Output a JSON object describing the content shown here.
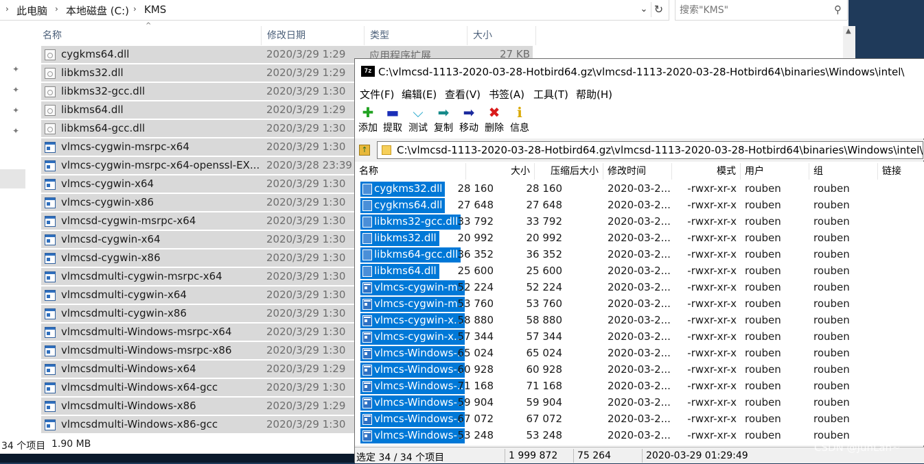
{
  "explorer": {
    "breadcrumb": [
      "此电脑",
      "本地磁盘 (C:)",
      "KMS"
    ],
    "search_placeholder": "搜索\"KMS\"",
    "columns": {
      "name": "名称",
      "date": "修改日期",
      "type": "类型",
      "size": "大小"
    },
    "files": [
      {
        "name": "cygkms64.dll",
        "date": "2020/3/29 1:29",
        "type": "应用程序扩展",
        "size": "27 KB",
        "kind": "dll"
      },
      {
        "name": "libkms32.dll",
        "date": "2020/3/29 1:29",
        "kind": "dll"
      },
      {
        "name": "libkms32-gcc.dll",
        "date": "2020/3/29 1:30",
        "kind": "dll"
      },
      {
        "name": "libkms64.dll",
        "date": "2020/3/29 1:29",
        "kind": "dll"
      },
      {
        "name": "libkms64-gcc.dll",
        "date": "2020/3/29 1:30",
        "kind": "dll"
      },
      {
        "name": "vlmcs-cygwin-msrpc-x64",
        "date": "2020/3/29 1:30",
        "kind": "exe"
      },
      {
        "name": "vlmcs-cygwin-msrpc-x64-openssl-EX...",
        "date": "2020/3/28 23:39",
        "kind": "exe"
      },
      {
        "name": "vlmcs-cygwin-x64",
        "date": "2020/3/29 1:30",
        "kind": "exe"
      },
      {
        "name": "vlmcs-cygwin-x86",
        "date": "2020/3/29 1:30",
        "kind": "exe"
      },
      {
        "name": "vlmcsd-cygwin-msrpc-x64",
        "date": "2020/3/29 1:30",
        "kind": "exe"
      },
      {
        "name": "vlmcsd-cygwin-x64",
        "date": "2020/3/29 1:30",
        "kind": "exe"
      },
      {
        "name": "vlmcsd-cygwin-x86",
        "date": "2020/3/29 1:30",
        "kind": "exe"
      },
      {
        "name": "vlmcsdmulti-cygwin-msrpc-x64",
        "date": "2020/3/29 1:30",
        "kind": "exe"
      },
      {
        "name": "vlmcsdmulti-cygwin-x64",
        "date": "2020/3/29 1:30",
        "kind": "exe"
      },
      {
        "name": "vlmcsdmulti-cygwin-x86",
        "date": "2020/3/29 1:30",
        "kind": "exe"
      },
      {
        "name": "vlmcsdmulti-Windows-msrpc-x64",
        "date": "2020/3/29 1:30",
        "kind": "exe"
      },
      {
        "name": "vlmcsdmulti-Windows-msrpc-x86",
        "date": "2020/3/29 1:30",
        "kind": "exe"
      },
      {
        "name": "vlmcsdmulti-Windows-x64",
        "date": "2020/3/29 1:29",
        "kind": "exe"
      },
      {
        "name": "vlmcsdmulti-Windows-x64-gcc",
        "date": "2020/3/29 1:30",
        "kind": "exe"
      },
      {
        "name": "vlmcsdmulti-Windows-x86",
        "date": "2020/3/29 1:29",
        "kind": "exe"
      },
      {
        "name": "vlmcsdmulti-Windows-x86-gcc",
        "date": "2020/3/29 1:30",
        "kind": "exe"
      }
    ],
    "status": {
      "count": "34 个项目",
      "size": "1.90 MB"
    }
  },
  "sevenzip": {
    "title": "C:\\vlmcsd-1113-2020-03-28-Hotbird64.gz\\vlmcsd-1113-2020-03-28-Hotbird64\\binaries\\Windows\\intel\\",
    "logo": "7z",
    "menu": [
      "文件(F)",
      "编辑(E)",
      "查看(V)",
      "书签(A)",
      "工具(T)",
      "帮助(H)"
    ],
    "tools": [
      {
        "label": "添加",
        "icon": "add-icon",
        "color": "#22a322"
      },
      {
        "label": "提取",
        "icon": "extract-icon",
        "color": "#1b2fb8"
      },
      {
        "label": "测试",
        "icon": "test-icon",
        "color": "#19a3c9"
      },
      {
        "label": "复制",
        "icon": "copy-icon",
        "color": "#158a8a"
      },
      {
        "label": "移动",
        "icon": "move-icon",
        "color": "#1b2a9e"
      },
      {
        "label": "删除",
        "icon": "delete-icon",
        "color": "#d91c1c"
      },
      {
        "label": "信息",
        "icon": "info-icon",
        "color": "#d9a800"
      }
    ],
    "path": "C:\\vlmcsd-1113-2020-03-28-Hotbird64.gz\\vlmcsd-1113-2020-03-28-Hotbird64\\binaries\\Windows\\intel\\",
    "columns": {
      "name": "名称",
      "size": "大小",
      "packed": "压缩后大小",
      "modified": "修改时间",
      "mode": "模式",
      "user": "用户",
      "group": "组",
      "link": "链接"
    },
    "rows": [
      {
        "name": "cygkms32.dll",
        "size": "28 160",
        "packed": "28 160",
        "modified": "2020-03-2...",
        "mode": "-rwxr-xr-x",
        "user": "rouben",
        "group": "rouben",
        "kind": "dll"
      },
      {
        "name": "cygkms64.dll",
        "size": "27 648",
        "packed": "27 648",
        "modified": "2020-03-2...",
        "mode": "-rwxr-xr-x",
        "user": "rouben",
        "group": "rouben",
        "kind": "dll"
      },
      {
        "name": "libkms32-gcc.dll",
        "size": "33 792",
        "packed": "33 792",
        "modified": "2020-03-2...",
        "mode": "-rwxr-xr-x",
        "user": "rouben",
        "group": "rouben",
        "kind": "dll"
      },
      {
        "name": "libkms32.dll",
        "size": "20 992",
        "packed": "20 992",
        "modified": "2020-03-2...",
        "mode": "-rwxr-xr-x",
        "user": "rouben",
        "group": "rouben",
        "kind": "dll"
      },
      {
        "name": "libkms64-gcc.dll",
        "size": "36 352",
        "packed": "36 352",
        "modified": "2020-03-2...",
        "mode": "-rwxr-xr-x",
        "user": "rouben",
        "group": "rouben",
        "kind": "dll"
      },
      {
        "name": "libkms64.dll",
        "size": "25 600",
        "packed": "25 600",
        "modified": "2020-03-2...",
        "mode": "-rwxr-xr-x",
        "user": "rouben",
        "group": "rouben",
        "kind": "dll"
      },
      {
        "name": "vlmcs-cygwin-m...",
        "size": "52 224",
        "packed": "52 224",
        "modified": "2020-03-2...",
        "mode": "-rwxr-xr-x",
        "user": "rouben",
        "group": "rouben",
        "kind": "exe"
      },
      {
        "name": "vlmcs-cygwin-m...",
        "size": "53 760",
        "packed": "53 760",
        "modified": "2020-03-2...",
        "mode": "-rwxr-xr-x",
        "user": "rouben",
        "group": "rouben",
        "kind": "exe"
      },
      {
        "name": "vlmcs-cygwin-x...",
        "size": "58 880",
        "packed": "58 880",
        "modified": "2020-03-2...",
        "mode": "-rwxr-xr-x",
        "user": "rouben",
        "group": "rouben",
        "kind": "exe"
      },
      {
        "name": "vlmcs-cygwin-x...",
        "size": "57 344",
        "packed": "57 344",
        "modified": "2020-03-2...",
        "mode": "-rwxr-xr-x",
        "user": "rouben",
        "group": "rouben",
        "kind": "exe"
      },
      {
        "name": "vlmcs-Windows-...",
        "size": "65 024",
        "packed": "65 024",
        "modified": "2020-03-2...",
        "mode": "-rwxr-xr-x",
        "user": "rouben",
        "group": "rouben",
        "kind": "exe"
      },
      {
        "name": "vlmcs-Windows-...",
        "size": "60 928",
        "packed": "60 928",
        "modified": "2020-03-2...",
        "mode": "-rwxr-xr-x",
        "user": "rouben",
        "group": "rouben",
        "kind": "exe"
      },
      {
        "name": "vlmcs-Windows-...",
        "size": "71 168",
        "packed": "71 168",
        "modified": "2020-03-2...",
        "mode": "-rwxr-xr-x",
        "user": "rouben",
        "group": "rouben",
        "kind": "exe"
      },
      {
        "name": "vlmcs-Windows-...",
        "size": "59 904",
        "packed": "59 904",
        "modified": "2020-03-2...",
        "mode": "-rwxr-xr-x",
        "user": "rouben",
        "group": "rouben",
        "kind": "exe"
      },
      {
        "name": "vlmcs-Windows-...",
        "size": "67 072",
        "packed": "67 072",
        "modified": "2020-03-2...",
        "mode": "-rwxr-xr-x",
        "user": "rouben",
        "group": "rouben",
        "kind": "exe"
      },
      {
        "name": "vlmcs-Windows-...",
        "size": "53 248",
        "packed": "53 248",
        "modified": "2020-03-2...",
        "mode": "-rwxr-xr-x",
        "user": "rouben",
        "group": "rouben",
        "kind": "exe"
      }
    ],
    "status": {
      "selected": "选定 34 / 34 个项目",
      "total": "1 999 872",
      "packed": "75 264",
      "time": "2020-03-29 01:29:49"
    }
  },
  "watermark": "CSDN @JunLan~"
}
